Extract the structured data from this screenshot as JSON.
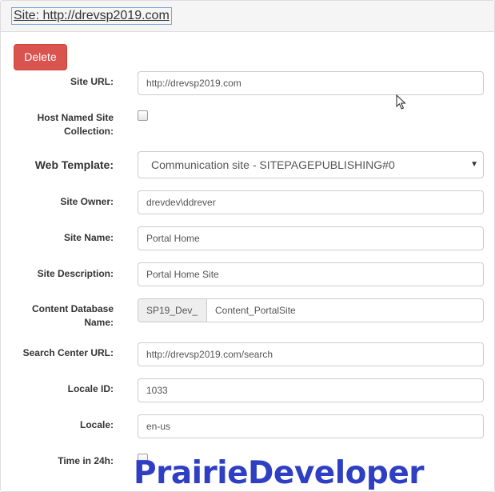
{
  "panel": {
    "title": "Site: http://drevsp2019.com"
  },
  "actions": {
    "delete_label": "Delete"
  },
  "form": {
    "site_url": {
      "label": "Site URL:",
      "value": "http://drevsp2019.com"
    },
    "host_named": {
      "label": "Host Named Site Collection:",
      "checked": false
    },
    "web_template": {
      "label": "Web Template:",
      "selected": "Communication site - SITEPAGEPUBLISHING#0"
    },
    "site_owner": {
      "label": "Site Owner:",
      "value": "drevdev\\ddrever"
    },
    "site_name": {
      "label": "Site Name:",
      "value": "Portal Home"
    },
    "site_description": {
      "label": "Site Description:",
      "value": "Portal Home Site"
    },
    "content_database": {
      "label": "Content Database Name:",
      "prefix": "SP19_Dev_",
      "value": "Content_PortalSite"
    },
    "search_center_url": {
      "label": "Search Center URL:",
      "value": "http://drevsp2019.com/search"
    },
    "locale_id": {
      "label": "Locale ID:",
      "value": "1033"
    },
    "locale": {
      "label": "Locale:",
      "value": "en-us"
    },
    "time_24h": {
      "label": "Time in 24h:",
      "checked": false
    }
  },
  "watermark": {
    "text": "PrairieDeveloper"
  },
  "icons": {
    "dropdown": "chevron-down-icon",
    "cursor": "mouse-pointer-icon"
  },
  "colors": {
    "delete_button": "#d9534f",
    "watermark": "#2e3fc4",
    "heading_bg": "#f5f5f5"
  }
}
